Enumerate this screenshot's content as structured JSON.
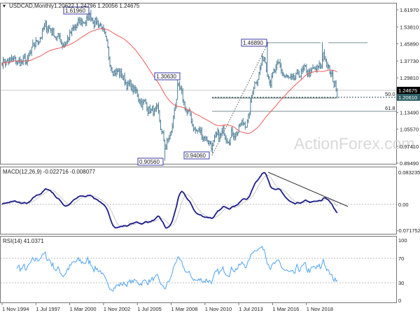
{
  "header": {
    "symbol": "USDCAD,Monthly",
    "ohlc": "1.20622 1.24796 1.20056 1.24675"
  },
  "price_axis": [
    "1.61970",
    "1.53810",
    "1.45890",
    "1.37730",
    "1.29810",
    "1.13490",
    "1.05570",
    "0.97410",
    "0.89490"
  ],
  "price_tags": {
    "last": "1.24675",
    "level": "1.20610"
  },
  "annotations": {
    "high_1": "1.61960",
    "low_1": "0.90560",
    "high_2": "1.30630",
    "low_2": "0.94060",
    "high_3": "1.46890",
    "fib_50": "50.0",
    "fib_618": "61.8"
  },
  "watermark": "ActionForex.com",
  "macd": {
    "title": "MACD(12,26,9) -0.022716 -0.008077",
    "axis": [
      "0.083235",
      "0.00",
      "-0.071752"
    ]
  },
  "rsi": {
    "title": "RSI(14) 41.0371",
    "axis": [
      "100",
      "70",
      "30",
      "0"
    ]
  },
  "time_axis": [
    "1 Nov 1994",
    "1 Jul 1997",
    "1 Mar 2000",
    "1 Nov 2002",
    "1 Jul 2005",
    "1 Mar 2008",
    "1 Nov 2010",
    "1 Jul 2013",
    "1 Mar 2016",
    "1 Nov 2018"
  ],
  "colors": {
    "bars": "#4f7f98",
    "sma": "#f05a5a",
    "macd": "#1c1c8c",
    "signal": "#c8c8c8",
    "rsi": "#4da3f0",
    "tag_last": "#000000",
    "tag_level": "#2f5f66"
  },
  "chart_data": {
    "type": "ohlc",
    "title": "USDCAD,Monthly",
    "x_unit": "months since Nov 1994",
    "ylim": [
      0.8949,
      1.6197
    ],
    "close_waypoints": [
      [
        0,
        1.38
      ],
      [
        12,
        1.37
      ],
      [
        24,
        1.37
      ],
      [
        38,
        1.52
      ],
      [
        44,
        1.54
      ],
      [
        58,
        1.46
      ],
      [
        64,
        1.5
      ],
      [
        76,
        1.56
      ],
      [
        84,
        1.59
      ],
      [
        94,
        1.55
      ],
      [
        101,
        1.38
      ],
      [
        114,
        1.3
      ],
      [
        130,
        1.2
      ],
      [
        147,
        1.12
      ],
      [
        154,
        0.97
      ],
      [
        160,
        1.03
      ],
      [
        166,
        1.25
      ],
      [
        172,
        1.17
      ],
      [
        183,
        1.05
      ],
      [
        193,
        1.02
      ],
      [
        199,
        0.98
      ],
      [
        209,
        1.03
      ],
      [
        222,
        1.05
      ],
      [
        233,
        1.1
      ],
      [
        238,
        1.27
      ],
      [
        248,
        1.4
      ],
      [
        254,
        1.3
      ],
      [
        262,
        1.34
      ],
      [
        275,
        1.26
      ],
      [
        282,
        1.32
      ],
      [
        292,
        1.32
      ],
      [
        302,
        1.34
      ],
      [
        304,
        1.42
      ],
      [
        309,
        1.33
      ],
      [
        314,
        1.27
      ],
      [
        317,
        1.2468
      ]
    ],
    "marked_extremes": [
      [
        84,
        1.6196,
        "high"
      ],
      [
        154,
        0.9056,
        "low"
      ],
      [
        166,
        1.3063,
        "high"
      ],
      [
        199,
        0.9406,
        "low"
      ],
      [
        251,
        1.4689,
        "high"
      ],
      [
        303,
        1.4669,
        "high"
      ]
    ],
    "sma_period": 55,
    "macd": {
      "fast": 12,
      "slow": 26,
      "signal": 9,
      "ylim": [
        -0.071752,
        0.083235
      ]
    },
    "rsi": {
      "period": 14,
      "levels": [
        30,
        70
      ],
      "ylim": [
        0,
        100
      ]
    }
  }
}
